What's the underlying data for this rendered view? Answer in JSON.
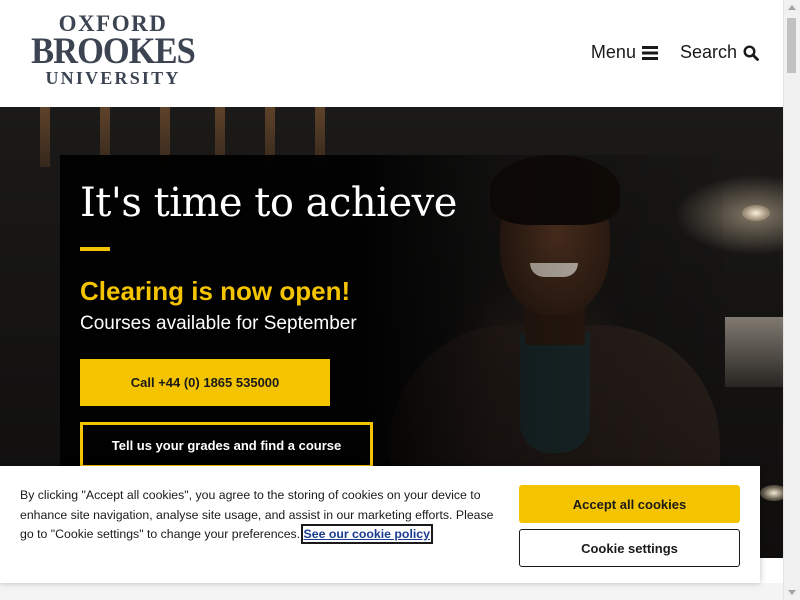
{
  "header": {
    "logo": {
      "line1": "OXFORD",
      "line2": "BROOKES",
      "line3": "UNIVERSITY"
    },
    "nav": {
      "menu_label": "Menu",
      "menu_icon": "hamburger-icon",
      "search_label": "Search",
      "search_icon": "search-icon"
    }
  },
  "hero": {
    "title": "It's time to achieve",
    "subtitle": "Clearing is now open!",
    "description": "Courses available for September",
    "call_button": "Call +44 (0) 1865 535000",
    "grades_button": "Tell us your grades and find a course"
  },
  "cookie_banner": {
    "text": "By clicking \"Accept all cookies\", you agree to the storing of cookies on your device to enhance site navigation, analyse site usage, and assist in our marketing efforts. Please go to \"Cookie settings\" to change your preferences.",
    "link_text": "See our cookie policy",
    "accept_button": "Accept all cookies",
    "settings_button": "Cookie settings"
  },
  "colors": {
    "accent_yellow": "#f5c400",
    "logo_text": "#3c4452",
    "link_blue": "#1a3d8f"
  }
}
